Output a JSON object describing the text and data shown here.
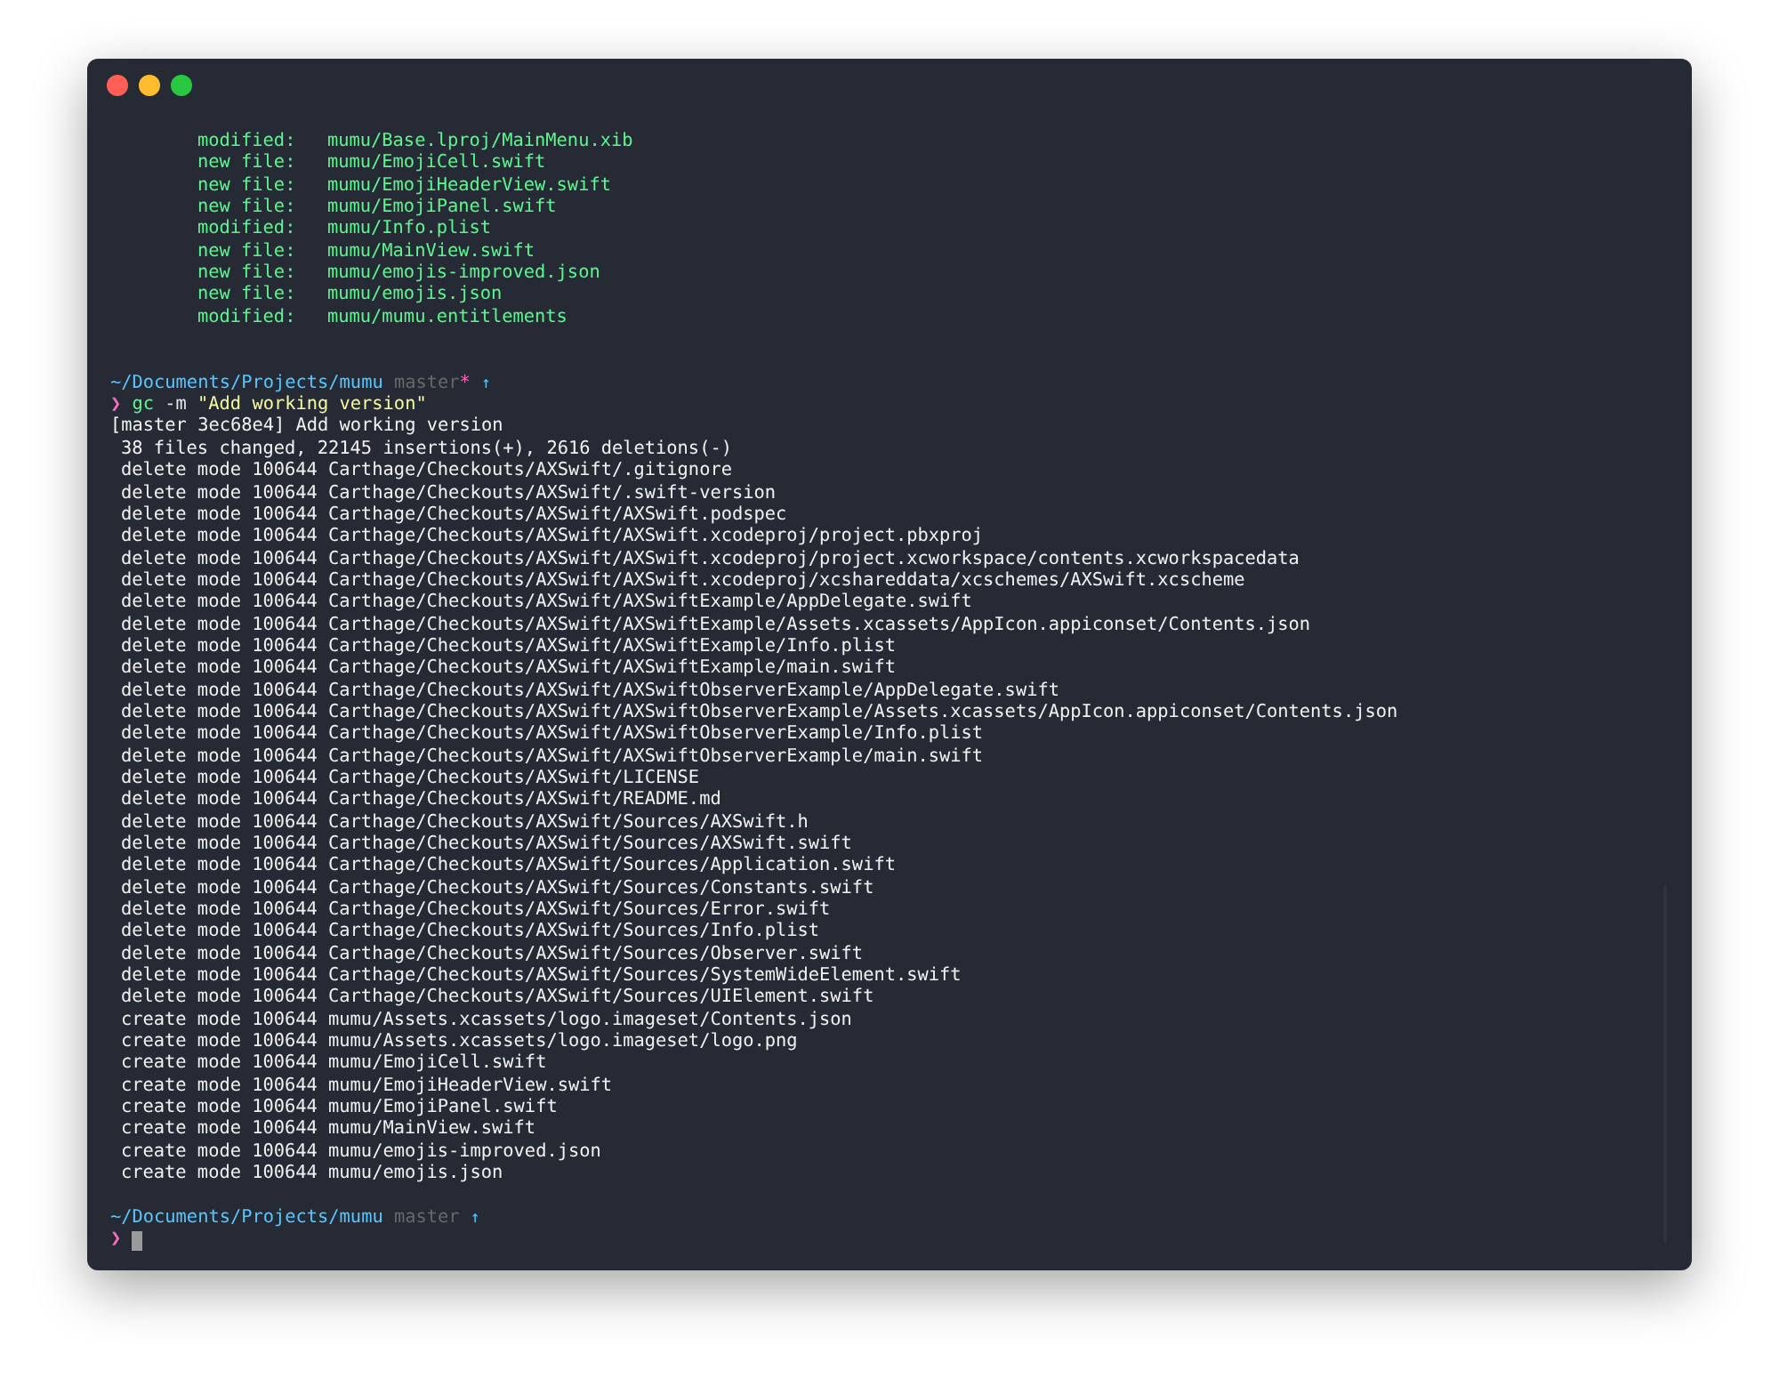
{
  "window": {
    "buttons": [
      {
        "kind": "close"
      },
      {
        "kind": "minimize"
      },
      {
        "kind": "zoom"
      }
    ]
  },
  "status_lines": [
    {
      "label": "modified:",
      "path": "mumu/Base.lproj/MainMenu.xib"
    },
    {
      "label": "new file:",
      "path": "mumu/EmojiCell.swift"
    },
    {
      "label": "new file:",
      "path": "mumu/EmojiHeaderView.swift"
    },
    {
      "label": "new file:",
      "path": "mumu/EmojiPanel.swift"
    },
    {
      "label": "modified:",
      "path": "mumu/Info.plist"
    },
    {
      "label": "new file:",
      "path": "mumu/MainView.swift"
    },
    {
      "label": "new file:",
      "path": "mumu/emojis-improved.json"
    },
    {
      "label": "new file:",
      "path": "mumu/emojis.json"
    },
    {
      "label": "modified:",
      "path": "mumu/mumu.entitlements"
    }
  ],
  "prompt_1": {
    "path": "~/Documents/Projects/mumu",
    "branch": "master",
    "dirty_mark": "*",
    "ahead_mark": "↑"
  },
  "command": {
    "prompt": "❯",
    "program": "gc",
    "flag": "-m",
    "argument": "\"Add working version\""
  },
  "output": [
    {
      "kind": "header",
      "text": "[master 3ec68e4] Add working version"
    },
    {
      "kind": "detail",
      "text": "38 files changed, 22145 insertions(+), 2616 deletions(-)"
    },
    {
      "kind": "detail",
      "text": "delete mode 100644 Carthage/Checkouts/AXSwift/.gitignore"
    },
    {
      "kind": "detail",
      "text": "delete mode 100644 Carthage/Checkouts/AXSwift/.swift-version"
    },
    {
      "kind": "detail",
      "text": "delete mode 100644 Carthage/Checkouts/AXSwift/AXSwift.podspec"
    },
    {
      "kind": "detail",
      "text": "delete mode 100644 Carthage/Checkouts/AXSwift/AXSwift.xcodeproj/project.pbxproj"
    },
    {
      "kind": "detail",
      "text": "delete mode 100644 Carthage/Checkouts/AXSwift/AXSwift.xcodeproj/project.xcworkspace/contents.xcworkspacedata"
    },
    {
      "kind": "detail",
      "text": "delete mode 100644 Carthage/Checkouts/AXSwift/AXSwift.xcodeproj/xcshareddata/xcschemes/AXSwift.xcscheme"
    },
    {
      "kind": "detail",
      "text": "delete mode 100644 Carthage/Checkouts/AXSwift/AXSwiftExample/AppDelegate.swift"
    },
    {
      "kind": "detail",
      "text": "delete mode 100644 Carthage/Checkouts/AXSwift/AXSwiftExample/Assets.xcassets/AppIcon.appiconset/Contents.json"
    },
    {
      "kind": "detail",
      "text": "delete mode 100644 Carthage/Checkouts/AXSwift/AXSwiftExample/Info.plist"
    },
    {
      "kind": "detail",
      "text": "delete mode 100644 Carthage/Checkouts/AXSwift/AXSwiftExample/main.swift"
    },
    {
      "kind": "detail",
      "text": "delete mode 100644 Carthage/Checkouts/AXSwift/AXSwiftObserverExample/AppDelegate.swift"
    },
    {
      "kind": "detail",
      "text": "delete mode 100644 Carthage/Checkouts/AXSwift/AXSwiftObserverExample/Assets.xcassets/AppIcon.appiconset/Contents.json"
    },
    {
      "kind": "detail",
      "text": "delete mode 100644 Carthage/Checkouts/AXSwift/AXSwiftObserverExample/Info.plist"
    },
    {
      "kind": "detail",
      "text": "delete mode 100644 Carthage/Checkouts/AXSwift/AXSwiftObserverExample/main.swift"
    },
    {
      "kind": "detail",
      "text": "delete mode 100644 Carthage/Checkouts/AXSwift/LICENSE"
    },
    {
      "kind": "detail",
      "text": "delete mode 100644 Carthage/Checkouts/AXSwift/README.md"
    },
    {
      "kind": "detail",
      "text": "delete mode 100644 Carthage/Checkouts/AXSwift/Sources/AXSwift.h"
    },
    {
      "kind": "detail",
      "text": "delete mode 100644 Carthage/Checkouts/AXSwift/Sources/AXSwift.swift"
    },
    {
      "kind": "detail",
      "text": "delete mode 100644 Carthage/Checkouts/AXSwift/Sources/Application.swift"
    },
    {
      "kind": "detail",
      "text": "delete mode 100644 Carthage/Checkouts/AXSwift/Sources/Constants.swift"
    },
    {
      "kind": "detail",
      "text": "delete mode 100644 Carthage/Checkouts/AXSwift/Sources/Error.swift"
    },
    {
      "kind": "detail",
      "text": "delete mode 100644 Carthage/Checkouts/AXSwift/Sources/Info.plist"
    },
    {
      "kind": "detail",
      "text": "delete mode 100644 Carthage/Checkouts/AXSwift/Sources/Observer.swift"
    },
    {
      "kind": "detail",
      "text": "delete mode 100644 Carthage/Checkouts/AXSwift/Sources/SystemWideElement.swift"
    },
    {
      "kind": "detail",
      "text": "delete mode 100644 Carthage/Checkouts/AXSwift/Sources/UIElement.swift"
    },
    {
      "kind": "detail",
      "text": "create mode 100644 mumu/Assets.xcassets/logo.imageset/Contents.json"
    },
    {
      "kind": "detail",
      "text": "create mode 100644 mumu/Assets.xcassets/logo.imageset/logo.png"
    },
    {
      "kind": "detail",
      "text": "create mode 100644 mumu/EmojiCell.swift"
    },
    {
      "kind": "detail",
      "text": "create mode 100644 mumu/EmojiHeaderView.swift"
    },
    {
      "kind": "detail",
      "text": "create mode 100644 mumu/EmojiPanel.swift"
    },
    {
      "kind": "detail",
      "text": "create mode 100644 mumu/MainView.swift"
    },
    {
      "kind": "detail",
      "text": "create mode 100644 mumu/emojis-improved.json"
    },
    {
      "kind": "detail",
      "text": "create mode 100644 mumu/emojis.json"
    }
  ],
  "prompt_2": {
    "path": "~/Documents/Projects/mumu",
    "branch": "master",
    "ahead_mark": "↑"
  },
  "input_line": {
    "prompt": "❯"
  }
}
